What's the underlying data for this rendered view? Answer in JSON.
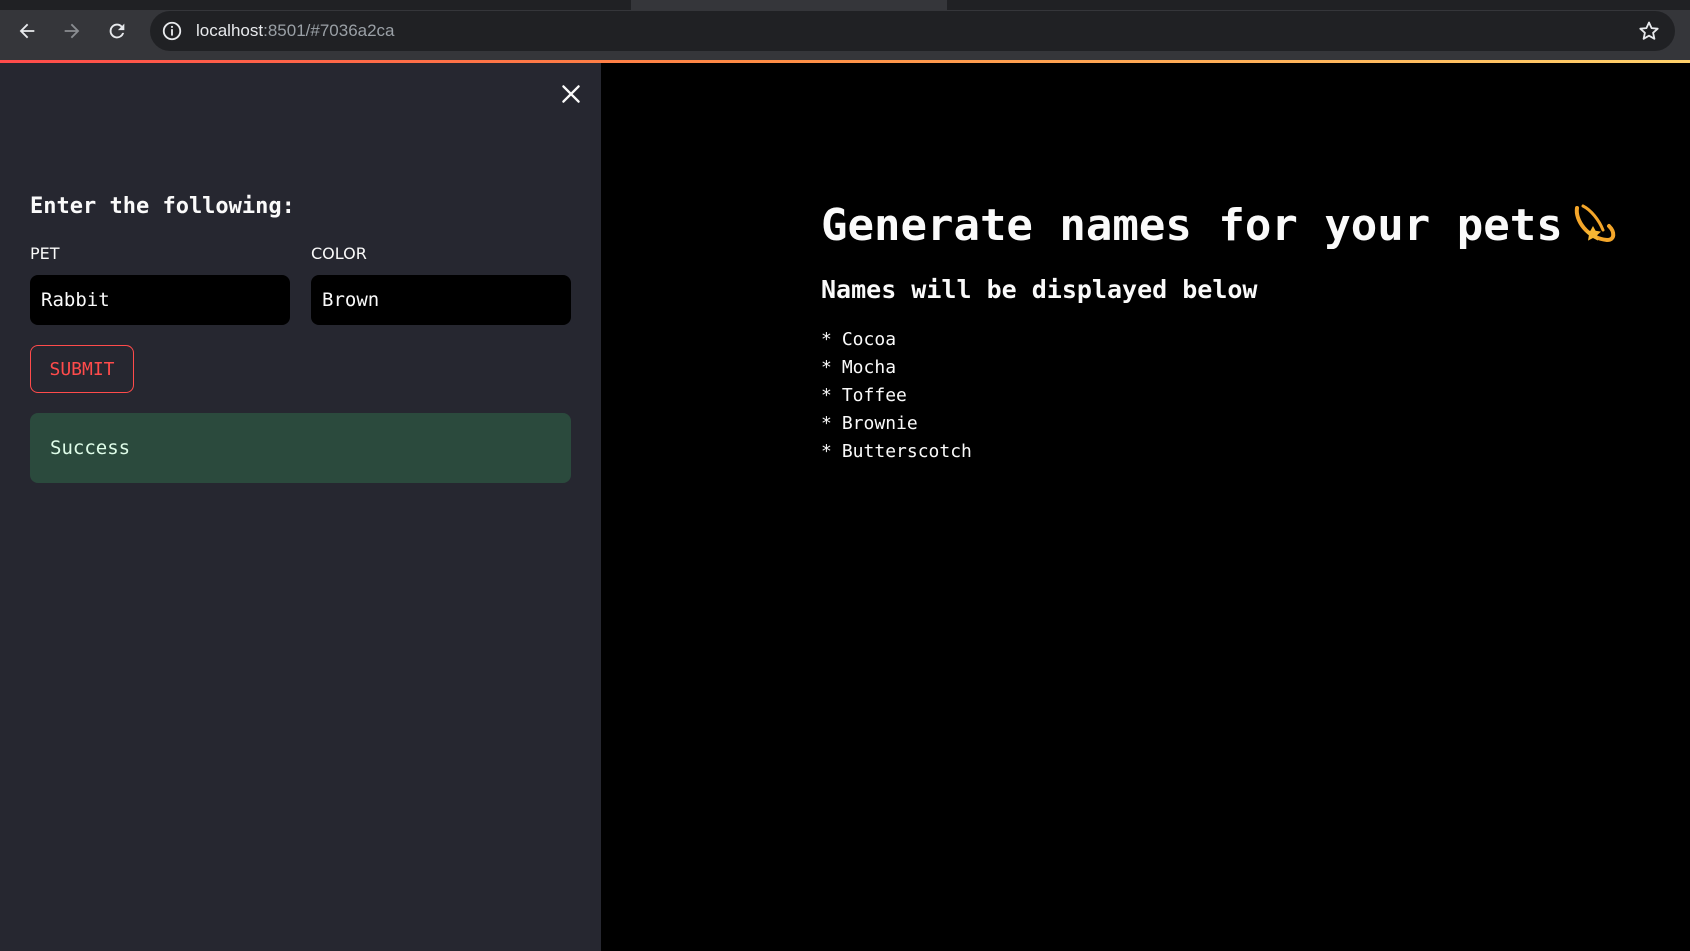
{
  "browser": {
    "url_host": "localhost",
    "url_rest": ":8501/#7036a2ca",
    "icons": {
      "back": "arrow-left-icon",
      "forward": "arrow-right-icon",
      "reload": "reload-icon",
      "info": "info-icon",
      "bookmark": "star-icon"
    }
  },
  "sidebar": {
    "close_icon": "close-icon",
    "heading": "Enter the following:",
    "fields": [
      {
        "label": "PET",
        "value": "Rabbit"
      },
      {
        "label": "COLOR",
        "value": "Brown"
      }
    ],
    "submit_label": "SUBMIT",
    "status_message": "Success"
  },
  "main": {
    "title": "Generate names for your pets",
    "title_icon": "dizzy-star-icon",
    "subtitle": "Names will be displayed below",
    "bullet": "*",
    "names": [
      "Cocoa",
      "Mocha",
      "Toffee",
      "Brownie",
      "Butterscotch"
    ]
  },
  "colors": {
    "sidebar_bg": "#262730",
    "main_bg": "#000000",
    "accent": "#ff4b4b",
    "success_bg": "#2b4a3d",
    "success_text": "#dffde9"
  }
}
